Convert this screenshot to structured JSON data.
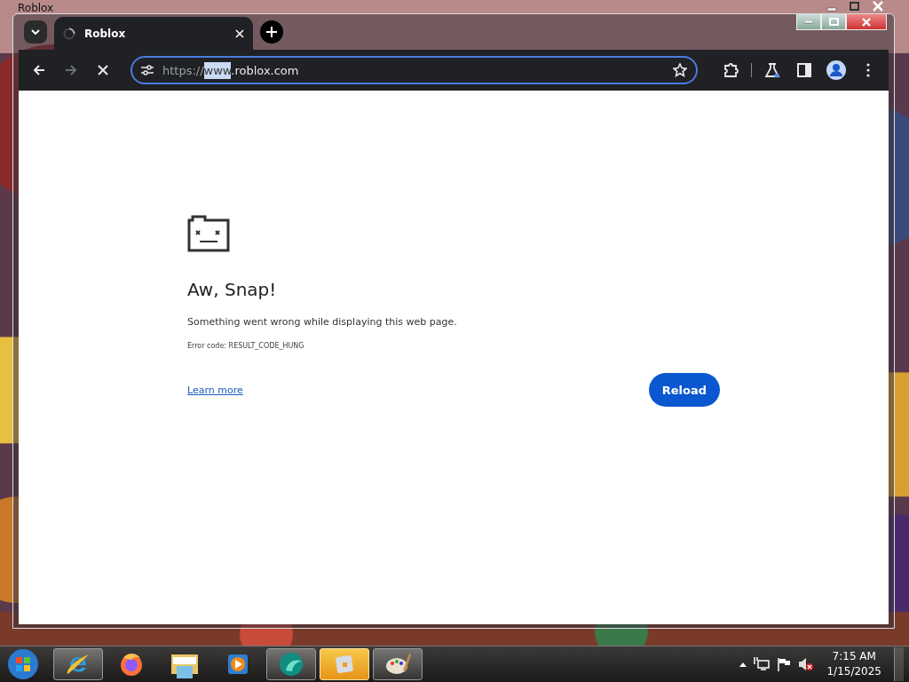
{
  "background_window": {
    "title": "Roblox"
  },
  "browser": {
    "tabs": [
      {
        "title": "Roblox",
        "loading": true,
        "selected": true
      }
    ],
    "address": {
      "scheme": "https://",
      "selected_text": "www",
      "rest": ".roblox.com"
    },
    "page": {
      "heading": "Aw, Snap!",
      "message": "Something went wrong while displaying this web page.",
      "error_code": "Error code: RESULT_CODE_HUNG",
      "link": "Learn more",
      "button": "Reload"
    }
  },
  "taskbar": {
    "items": [
      {
        "kind": "ie",
        "running": true,
        "selected": false
      },
      {
        "kind": "firefox",
        "running": false,
        "selected": false
      },
      {
        "kind": "explorer",
        "running": false,
        "selected": false
      },
      {
        "kind": "media",
        "running": false,
        "selected": false
      },
      {
        "kind": "teal",
        "running": true,
        "selected": false
      },
      {
        "kind": "roblox",
        "running": true,
        "selected": true
      },
      {
        "kind": "paint",
        "running": true,
        "selected": false
      }
    ],
    "time": "7:15 AM",
    "date": "1/15/2025"
  }
}
